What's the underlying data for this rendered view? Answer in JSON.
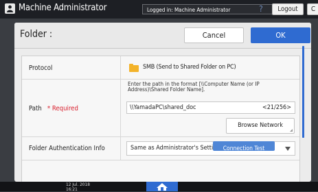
{
  "header": {
    "user_name": "Machine Administrator",
    "login_status": "Logged in: Machine Administrator",
    "help_label": "?",
    "logout_label": "Logout",
    "exit_label": "C"
  },
  "dialog": {
    "title": "Folder :",
    "cancel_label": "Cancel",
    "ok_label": "OK"
  },
  "protocol": {
    "label": "Protocol",
    "value": "SMB (Send to Shared Folder on PC)",
    "icon": "folder-icon"
  },
  "path": {
    "label": "Path",
    "required_star": "*",
    "required_text": "Required",
    "instruction": "Enter the path in the format [\\\\Computer Name (or IP Address)\\Shared Folder Name].",
    "value": "\\\\YamadaPC\\shared_doc",
    "char_count": "<21/256>",
    "browse_label": "Browse Network"
  },
  "auth": {
    "label": "Folder Authentication Info",
    "selected": "Same as Administrator's Settings"
  },
  "connection_test_label": "Connection Test",
  "footer": {
    "date": "12 Jul. 2018",
    "time": "16:21"
  },
  "colors": {
    "accent": "#2f6bd1",
    "required": "#d9202e",
    "folder": "#f3b32a"
  }
}
